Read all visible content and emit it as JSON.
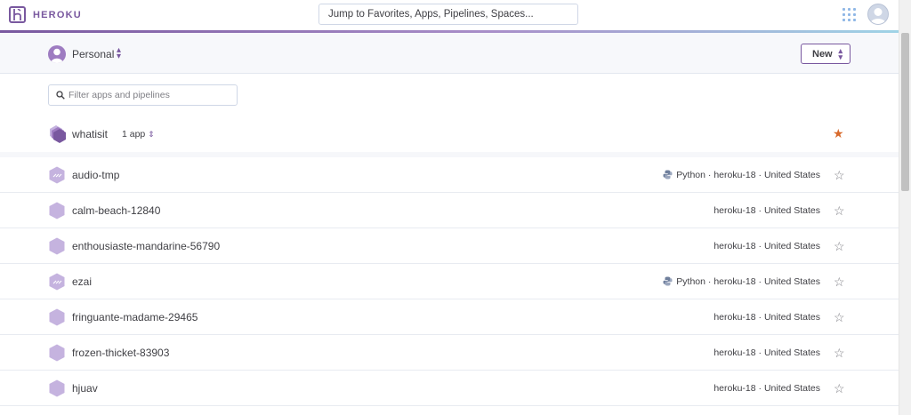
{
  "brand": {
    "name": "HEROKU"
  },
  "search": {
    "placeholder": "Jump to Favorites, Apps, Pipelines, Spaces..."
  },
  "account": {
    "label": "Personal"
  },
  "actions": {
    "new_label": "New"
  },
  "filter": {
    "placeholder": "Filter apps and pipelines"
  },
  "team": {
    "name": "whatisit",
    "count": "1 app",
    "favorited": true
  },
  "apps": [
    {
      "name": "audio-tmp",
      "language": "Python",
      "stack": "heroku-18",
      "region": "United States"
    },
    {
      "name": "calm-beach-12840",
      "language": "",
      "stack": "heroku-18",
      "region": "United States"
    },
    {
      "name": "enthousiaste-mandarine-56790",
      "language": "",
      "stack": "heroku-18",
      "region": "United States"
    },
    {
      "name": "ezai",
      "language": "Python",
      "stack": "heroku-18",
      "region": "United States"
    },
    {
      "name": "fringuante-madame-29465",
      "language": "",
      "stack": "heroku-18",
      "region": "United States"
    },
    {
      "name": "frozen-thicket-83903",
      "language": "",
      "stack": "heroku-18",
      "region": "United States"
    },
    {
      "name": "hjuav",
      "language": "",
      "stack": "heroku-18",
      "region": "United States"
    }
  ],
  "colors": {
    "brand": "#79589f",
    "star_active": "#d86a2c",
    "star_inactive": "#7f7f85"
  },
  "icons": {
    "logo": "heroku-logo-icon",
    "apps": "apps-grid-icon",
    "user": "user-avatar-icon",
    "search": "search-icon",
    "star": "star-icon",
    "python": "python-icon",
    "app": "app-hexagon-icon"
  }
}
